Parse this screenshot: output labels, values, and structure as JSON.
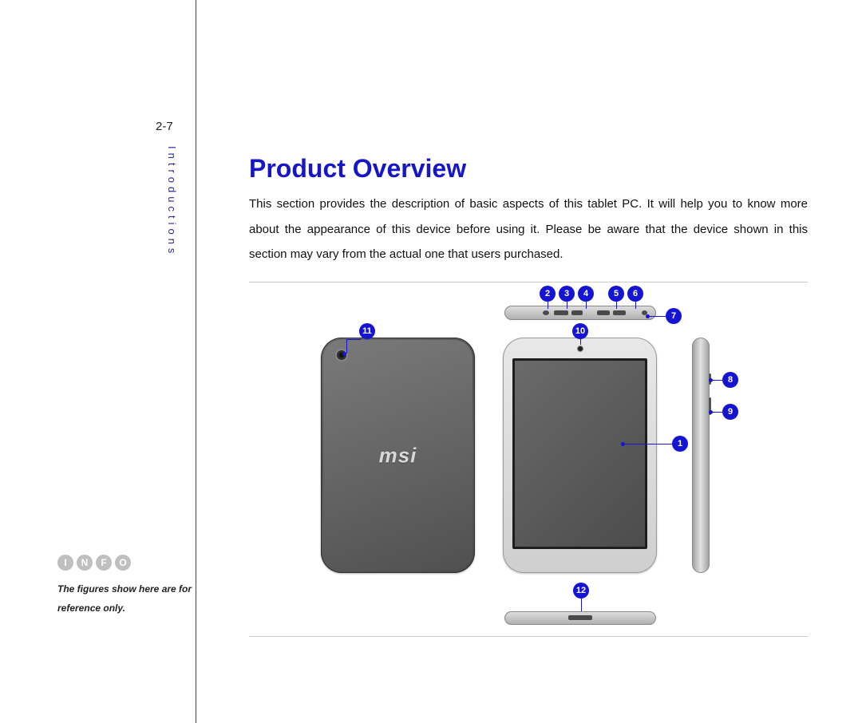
{
  "page_number": "2-7",
  "sidebar_label": "Introductions",
  "info_badge": [
    "I",
    "N",
    "F",
    "O"
  ],
  "info_note": "The figures show here are for reference only.",
  "heading": "Product Overview",
  "body": "This section provides the description of basic aspects of this tablet PC. It will help you to know more about the appearance of this device before using it. Please be aware that the device shown in this section may vary from the actual one that users purchased.",
  "brand_logo": "msi",
  "callouts": {
    "c1": "1",
    "c2": "2",
    "c3": "3",
    "c4": "4",
    "c5": "5",
    "c6": "6",
    "c7": "7",
    "c8": "8",
    "c9": "9",
    "c10": "10",
    "c11": "11",
    "c12": "12"
  }
}
